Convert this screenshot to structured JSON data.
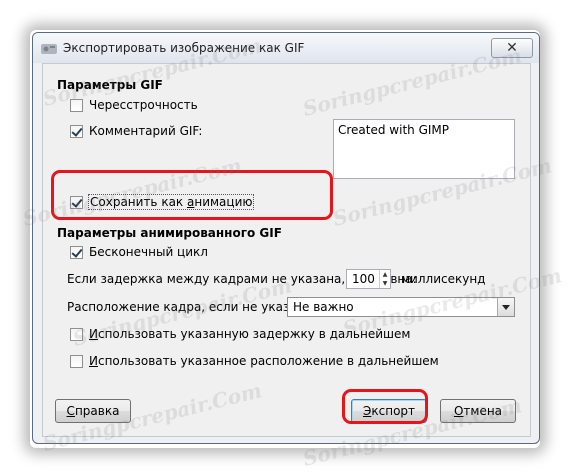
{
  "window": {
    "title": "Экспортировать изображение как GIF",
    "close_glyph": "✕"
  },
  "gif_params": {
    "heading": "Параметры GIF",
    "interlace": {
      "label": "Чересстрочность",
      "checked": false
    },
    "comment": {
      "label": "Комментарий GIF:",
      "checked": true,
      "value": "Created with GIMP"
    },
    "as_animation": {
      "label_pre": "Сохранить как ",
      "label_underlined": "а",
      "label_post": "нимацию",
      "checked": true
    }
  },
  "anim_params": {
    "heading": "Параметры анимированного GIF",
    "loop": {
      "label": "Бесконечный цикл",
      "checked": true
    },
    "delay": {
      "label": "Если задержка между кадрами не указана, она равна:",
      "value": "100",
      "unit": "миллисекунд"
    },
    "disposal": {
      "label": "Расположение кадра, если не указано:",
      "value": "Не важно"
    },
    "use_delay": {
      "label_underlined": "И",
      "label_rest": "спользовать указанную задержку в дальнейшем",
      "checked": false
    },
    "use_disposal": {
      "label_underlined": "И",
      "label_rest": "спользовать указанное расположение в дальнейшем",
      "checked": false
    }
  },
  "buttons": {
    "help": {
      "underlined": "С",
      "rest": "правка"
    },
    "export": {
      "underlined": "Э",
      "rest": "кспорт"
    },
    "cancel": {
      "underlined": "О",
      "rest": "тмена"
    }
  },
  "watermark": "Soringpcrepair.Com",
  "colors": {
    "highlight": "#e8141c"
  }
}
